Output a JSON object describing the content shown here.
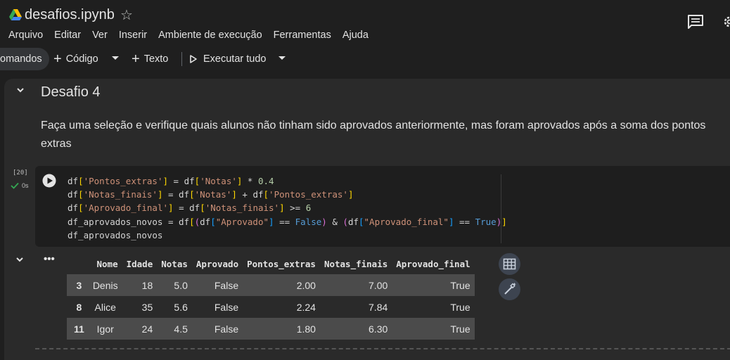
{
  "header": {
    "title": "desafios.ipynb",
    "menu": [
      "Arquivo",
      "Editar",
      "Ver",
      "Inserir",
      "Ambiente de execução",
      "Ferramentas",
      "Ajuda"
    ]
  },
  "toolbar": {
    "commands_label": "omandos",
    "code_label": "Código",
    "text_label": "Texto",
    "run_all_label": "Executar tudo"
  },
  "markdown_cell": {
    "title": "Desafio 4",
    "text": "Faça uma seleção e verifique quais alunos não tinham sido aprovados anteriormente, mas foram aprovados após a soma dos pontos extras"
  },
  "code_cell": {
    "execution_count": "[20]",
    "execution_time": "0s",
    "lines": [
      "df['Pontos_extras'] = df['Notas'] * 0.4",
      "df['Notas_finais'] = df['Notas'] + df['Pontos_extras']",
      "df['Aprovado_final'] = df['Notas_finais'] >= 6",
      "df_aprovados_novos = df[(df[\"Aprovado\"] == False) & (df[\"Aprovado_final\"] == True)]",
      "df_aprovados_novos"
    ]
  },
  "output": {
    "columns": [
      "",
      "Nome",
      "Idade",
      "Notas",
      "Aprovado",
      "Pontos_extras",
      "Notas_finais",
      "Aprovado_final"
    ],
    "rows": [
      [
        "3",
        "Denis",
        "18",
        "5.0",
        "False",
        "2.00",
        "7.00",
        "True"
      ],
      [
        "8",
        "Alice",
        "35",
        "5.6",
        "False",
        "2.24",
        "7.84",
        "True"
      ],
      [
        "11",
        "Igor",
        "24",
        "4.5",
        "False",
        "1.80",
        "6.30",
        "True"
      ]
    ]
  },
  "colors": {
    "background": "#1f1f1f",
    "cell_background": "#2a2a2a",
    "code_background": "#1e1e1e",
    "success": "#34a853"
  }
}
